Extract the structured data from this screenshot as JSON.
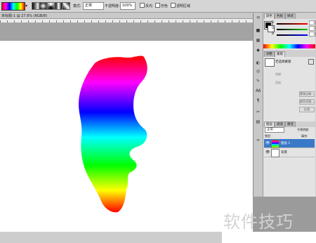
{
  "options_bar": {
    "mode_label": "模式:",
    "mode_value": "正常",
    "opacity_label": "不透明度:",
    "opacity_value": "100%",
    "reverse_label": "反向",
    "dither_label": "仿色",
    "transparency_label": "透明区域"
  },
  "document": {
    "tab_title": "未标题-1 @ 27.6% (RGB/8)"
  },
  "color_panel": {
    "tabs": [
      "颜色",
      "色板",
      "样式"
    ],
    "sliders": [
      {
        "letter": "R",
        "value": "0",
        "color": "#ff0000"
      },
      {
        "letter": "G",
        "value": "0",
        "color": "#00c000"
      },
      {
        "letter": "B",
        "value": "0",
        "color": "#0000ff"
      }
    ]
  },
  "adjust_panel": {
    "tabs": [
      "调整",
      "蒙版"
    ],
    "title": "无选择蒙版",
    "density_label": "浓度:",
    "feather_label": "羽化:",
    "buttons": [
      "蒙版边缘...",
      "颜色范围...",
      "反相"
    ]
  },
  "layers_panel": {
    "tabs": [
      "图层",
      "通道",
      "路径"
    ],
    "blend_mode": "正常",
    "opacity_label": "不透明度:",
    "lock_label": "锁定:",
    "fill_label": "填充:",
    "layers": [
      {
        "name": "图层 1",
        "selected": true
      },
      {
        "name": "背景",
        "selected": false
      }
    ]
  },
  "watermark": "软件技巧",
  "colors": {
    "selected_layer": "#3a78c8",
    "canvas": "#ffffff",
    "workspace": "#9b9b9b"
  }
}
